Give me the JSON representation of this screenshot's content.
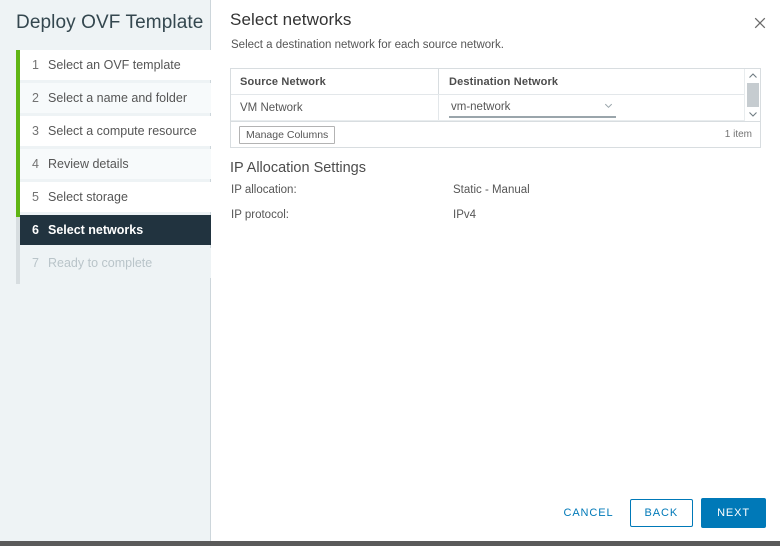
{
  "wizard": {
    "title": "Deploy OVF Template",
    "steps": [
      {
        "num": "1",
        "label": "Select an OVF template",
        "state": "done"
      },
      {
        "num": "2",
        "label": "Select a name and folder",
        "state": "done"
      },
      {
        "num": "3",
        "label": "Select a compute resource",
        "state": "done"
      },
      {
        "num": "4",
        "label": "Review details",
        "state": "done"
      },
      {
        "num": "5",
        "label": "Select storage",
        "state": "done"
      },
      {
        "num": "6",
        "label": "Select networks",
        "state": "active"
      },
      {
        "num": "7",
        "label": "Ready to complete",
        "state": "disabled"
      }
    ]
  },
  "header": {
    "title": "Select networks",
    "subtitle": "Select a destination network for each source network.",
    "close_icon": "close-icon"
  },
  "grid": {
    "columns": [
      "Source Network",
      "Destination Network"
    ],
    "rows": [
      {
        "source": "VM Network",
        "destination": "vm-network"
      }
    ],
    "manage_columns_label": "Manage Columns",
    "item_count": "1 item"
  },
  "ip_allocation": {
    "section_title": "IP Allocation Settings",
    "fields": [
      {
        "key": "IP allocation:",
        "value": "Static - Manual"
      },
      {
        "key": "IP protocol:",
        "value": "IPv4"
      }
    ]
  },
  "footer": {
    "cancel_label": "CANCEL",
    "back_label": "BACK",
    "next_label": "NEXT"
  },
  "colors": {
    "accent_blue": "#0079b8",
    "progress_green": "#60b515",
    "active_step_bg": "#21333f",
    "sidebar_bg": "#eef3f5"
  }
}
